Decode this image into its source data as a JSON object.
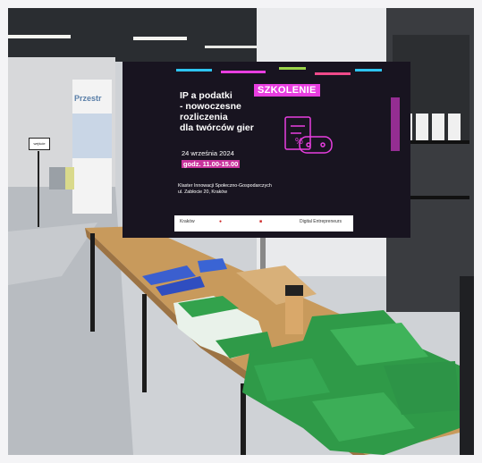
{
  "slide": {
    "title": "IP a podatki\n- nowoczesne\nrozliczenia\ndla twórców gier",
    "badge": "SZKOLENIE",
    "date": "24 września 2024",
    "time": "godz. 11.00-15.00",
    "venue_line1": "Klaster Innowacji Społeczno-Gospodarczych",
    "venue_line2": "ul. Zabłocie 20, Kraków"
  },
  "logos": {
    "krakow": "Kraków",
    "digital": "Digital Entrepreneurs"
  },
  "banner": {
    "text": "Przestr"
  },
  "colors": {
    "screen_bg": "#181420",
    "badge": "#e83ee0",
    "table": "#c89a5c",
    "bags": "#2f9a48"
  }
}
